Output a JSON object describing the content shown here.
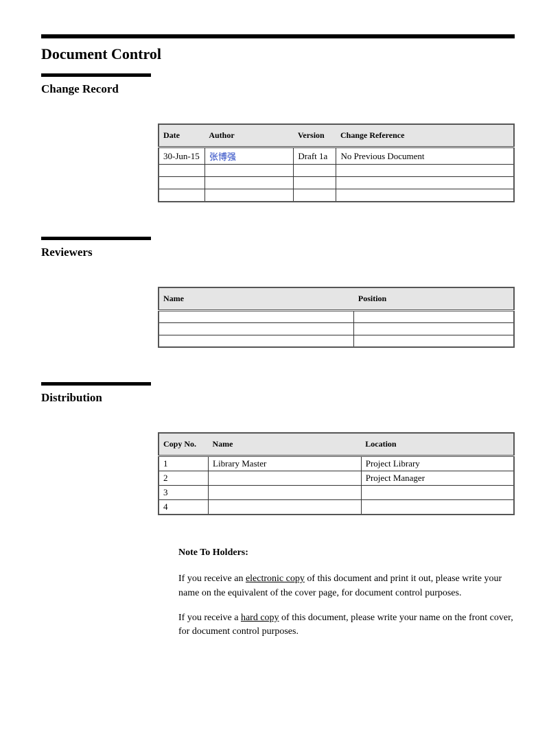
{
  "title": "Document Control",
  "sections": {
    "change_record": {
      "heading": "Change Record",
      "columns": {
        "date": "Date",
        "author": "Author",
        "version": "Version",
        "change_ref": "Change Reference"
      },
      "rows": [
        {
          "date": "30-Jun-15",
          "author": "张博强",
          "version": "Draft 1a",
          "change_ref": "No Previous Document"
        },
        {
          "date": "",
          "author": "",
          "version": "",
          "change_ref": ""
        },
        {
          "date": "",
          "author": "",
          "version": "",
          "change_ref": ""
        },
        {
          "date": "",
          "author": "",
          "version": "",
          "change_ref": ""
        }
      ]
    },
    "reviewers": {
      "heading": "Reviewers",
      "columns": {
        "name": "Name",
        "position": "Position"
      },
      "rows": [
        {
          "name": "",
          "position": ""
        },
        {
          "name": "",
          "position": ""
        },
        {
          "name": "",
          "position": ""
        }
      ]
    },
    "distribution": {
      "heading": "Distribution",
      "columns": {
        "copy_no": "Copy No.",
        "name": "Name",
        "location": "Location"
      },
      "rows": [
        {
          "copy_no": "1",
          "name": "Library Master",
          "location": "Project Library"
        },
        {
          "copy_no": "2",
          "name": "",
          "location": "Project Manager"
        },
        {
          "copy_no": "3",
          "name": "",
          "location": ""
        },
        {
          "copy_no": "4",
          "name": "",
          "location": ""
        }
      ]
    }
  },
  "note": {
    "title": "Note To Holders:",
    "p1_a": "If you receive an ",
    "p1_u": "electronic copy",
    "p1_b": " of this document and print it out, please write your name on the equivalent of the cover page, for document control purposes.",
    "p2_a": "If you receive a ",
    "p2_u": "hard copy",
    "p2_b": " of this document, please write your name on the front cover, for document control purposes."
  }
}
